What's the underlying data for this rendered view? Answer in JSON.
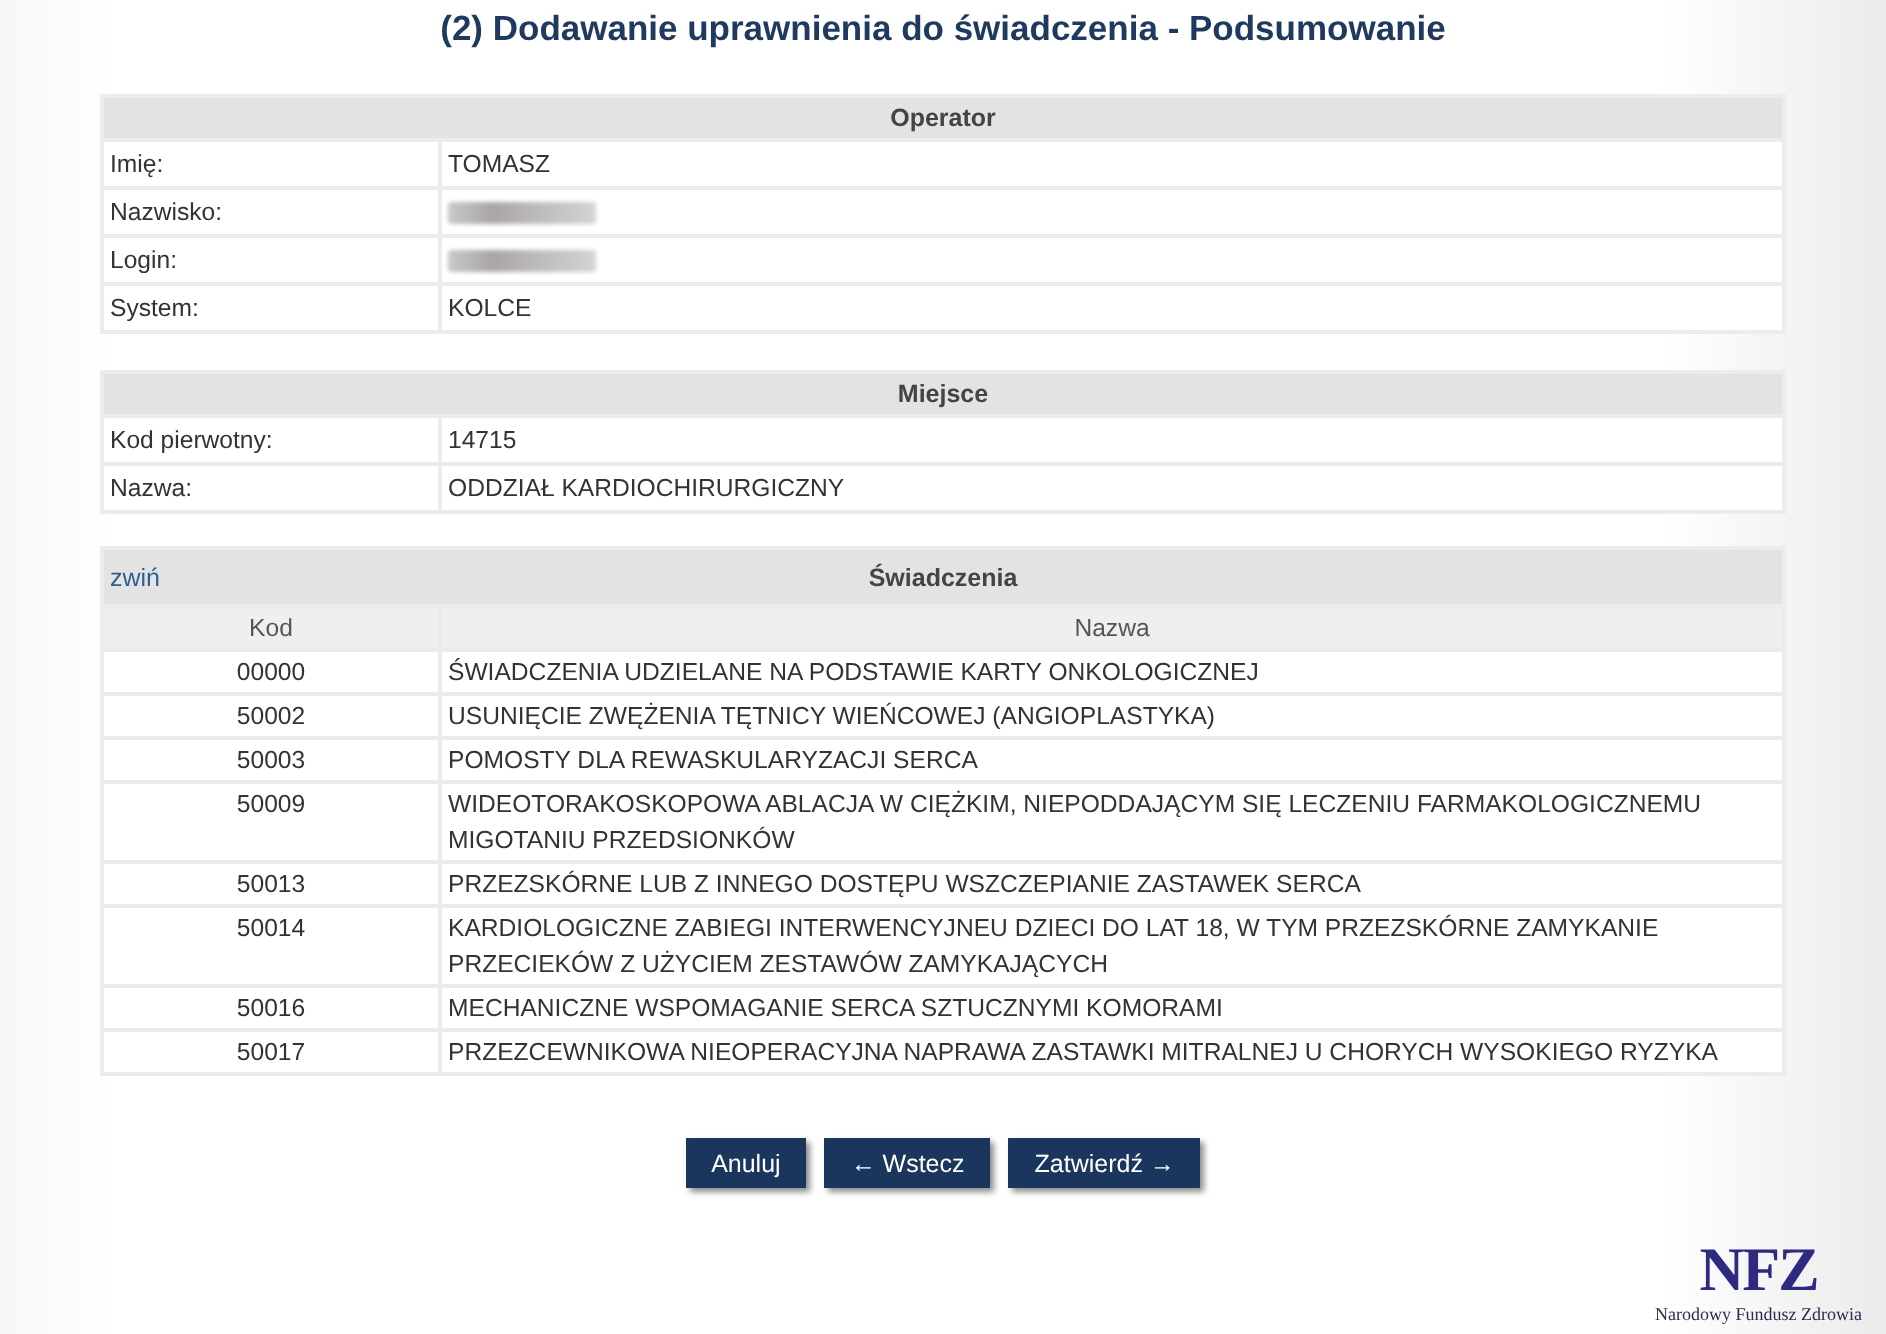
{
  "page": {
    "title": "(2) Dodawanie uprawnienia do świadczenia - Podsumowanie"
  },
  "operator": {
    "heading": "Operator",
    "rows": [
      {
        "label": "Imię:",
        "value": "TOMASZ"
      },
      {
        "label": "Nazwisko:",
        "blurred": true
      },
      {
        "label": "Login:",
        "blurred": true
      },
      {
        "label": "System:",
        "value": "KOLCE"
      }
    ]
  },
  "place": {
    "heading": "Miejsce",
    "rows": [
      {
        "label": "Kod pierwotny:",
        "value": "14715"
      },
      {
        "label": "Nazwa:",
        "value": "ODDZIAŁ KARDIOCHIRURGICZNY"
      }
    ]
  },
  "services": {
    "toggle": "zwiń",
    "heading": "Świadczenia",
    "columns": [
      "Kod",
      "Nazwa"
    ],
    "rows": [
      {
        "code": "00000",
        "name": "ŚWIADCZENIA UDZIELANE NA PODSTAWIE KARTY ONKOLOGICZNEJ"
      },
      {
        "code": "50002",
        "name": "USUNIĘCIE ZWĘŻENIA TĘTNICY WIEŃCOWEJ (ANGIOPLASTYKA)"
      },
      {
        "code": "50003",
        "name": "POMOSTY DLA REWASKULARYZACJI SERCA"
      },
      {
        "code": "50009",
        "name": "WIDEOTORAKOSKOPOWA ABLACJA W CIĘŻKIM, NIEPODDAJĄCYM SIĘ LECZENIU FARMAKOLOGICZNEMU MIGOTANIU PRZEDSIONKÓW"
      },
      {
        "code": "50013",
        "name": "PRZEZSKÓRNE LUB Z INNEGO DOSTĘPU WSZCZEPIANIE ZASTAWEK SERCA"
      },
      {
        "code": "50014",
        "name": "KARDIOLOGICZNE ZABIEGI INTERWENCYJNEU DZIECI DO LAT 18, W TYM PRZEZSKÓRNE ZAMYKANIE PRZECIEKÓW Z UŻYCIEM ZESTAWÓW ZAMYKAJĄCYCH"
      },
      {
        "code": "50016",
        "name": "MECHANICZNE WSPOMAGANIE SERCA SZTUCZNYMI KOMORAMI"
      },
      {
        "code": "50017",
        "name": "PRZEZCEWNIKOWA NIEOPERACYJNA NAPRAWA ZASTAWKI MITRALNEJ U CHORYCH WYSOKIEGO RYZYKA"
      }
    ]
  },
  "buttons": [
    "Anuluj",
    "← Wstecz",
    "Zatwierdź →"
  ],
  "logo": {
    "mark": "NFZ",
    "caption": "Narodowy Fundusz Zdrowia"
  }
}
